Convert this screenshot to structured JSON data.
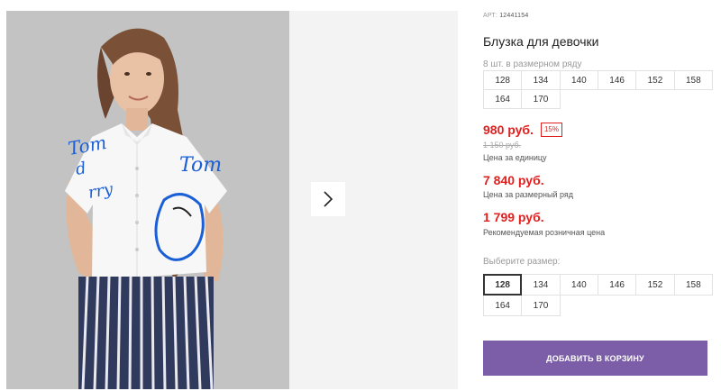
{
  "product": {
    "article_label": "АРТ:",
    "article_number": "12441154",
    "title": "Блузка для девочки"
  },
  "series": {
    "label": "8 шт. в размерном ряду",
    "sizes": [
      "128",
      "134",
      "140",
      "146",
      "152",
      "158",
      "164",
      "170"
    ]
  },
  "pricing": {
    "price": "980 руб.",
    "discount": "15%",
    "old_price": "1 150 руб.",
    "unit_note": "Цена за единицу",
    "series_price": "7 840 руб.",
    "series_note": "Цена за размерный ряд",
    "rrp_price": "1 799 руб.",
    "rrp_note": "Рекомендуемая розничная цена"
  },
  "size_select": {
    "label": "Выберите размер:",
    "selected": "128",
    "sizes": [
      "128",
      "134",
      "140",
      "146",
      "152",
      "158",
      "164",
      "170"
    ]
  },
  "actions": {
    "add_to_cart": "ДОБАВИТЬ В КОРЗИНУ"
  },
  "gallery": {
    "shirt_print_left": "Tom and Jerry",
    "shirt_print_right": "Tom",
    "next_icon": "chevron-right-icon"
  },
  "colors": {
    "price_red": "#e0201f",
    "button_purple": "#7b5ea7",
    "print_blue": "#1a5fd6"
  }
}
